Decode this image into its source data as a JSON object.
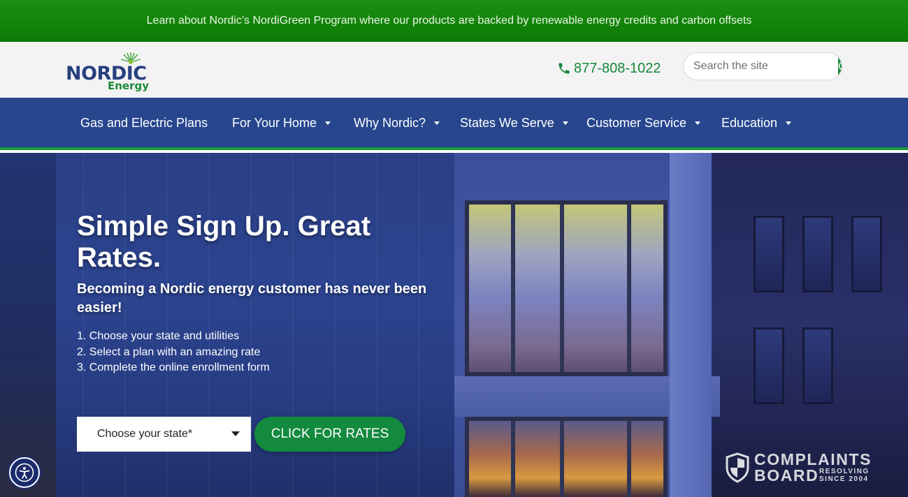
{
  "promo": {
    "text": "Learn about Nordic’s NordiGreen Program where our products are backed by renewable energy credits and carbon offsets"
  },
  "header": {
    "logo_primary": "NORDIC",
    "logo_secondary": "Energy",
    "phone": "877-808-1022",
    "search_placeholder": "Search the site"
  },
  "nav": {
    "items": [
      {
        "label": "Gas and Electric Plans",
        "dropdown": false
      },
      {
        "label": "For Your Home",
        "dropdown": true
      },
      {
        "label": "Why Nordic?",
        "dropdown": true
      },
      {
        "label": "States We Serve",
        "dropdown": true
      },
      {
        "label": "Customer Service",
        "dropdown": true
      },
      {
        "label": "Education",
        "dropdown": true
      }
    ]
  },
  "hero": {
    "title": "Simple Sign Up. Great Rates.",
    "subtitle": "Becoming a Nordic energy customer has never been easier!",
    "steps": [
      "1. Choose your state and utilities",
      "2. Select a plan with an amazing rate",
      "3. Complete the online enrollment form"
    ],
    "state_select_value": "Choose your state*",
    "cta_label": "CLICK FOR RATES"
  },
  "badge": {
    "line1": "COMPLAINTS",
    "line2": "BOARD",
    "tag1": "RESOLVING",
    "tag2": "SINCE 2004"
  },
  "colors": {
    "promo_green": "#138a0c",
    "brand_blue": "#27468e",
    "brand_green": "#1a8a3c",
    "header_bg": "#f3f3f3"
  },
  "icons": [
    "phone-icon",
    "search-icon",
    "caret-down-icon",
    "accessibility-icon",
    "shield-icon",
    "sunburst-icon"
  ]
}
